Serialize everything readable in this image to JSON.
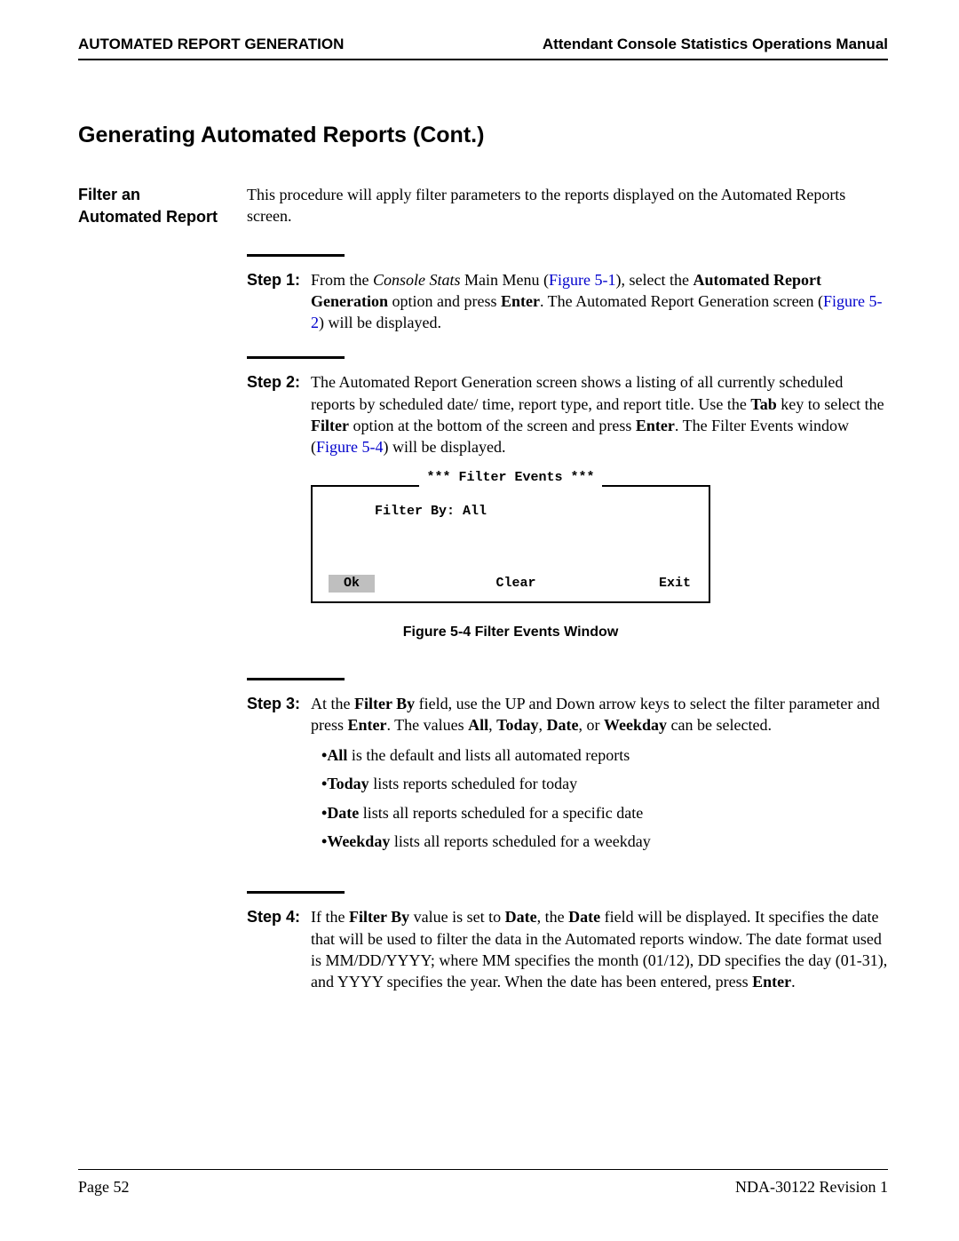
{
  "header": {
    "left": "AUTOMATED REPORT GENERATION",
    "right": "Attendant Console Statistics Operations Manual"
  },
  "section_title": "Generating Automated Reports (Cont.)",
  "left_heading_line1": "Filter an",
  "left_heading_line2": "Automated Report",
  "intro": "This procedure will apply filter parameters to the reports displayed on the Automated Reports screen.",
  "steps": {
    "s1": {
      "label": "Step 1:",
      "pre1": "From the ",
      "italic1": "Console Stats",
      "mid1": " Main Menu (",
      "link1": "Figure 5-1",
      "mid2": "), select the ",
      "bold1": "Automated Report Generation",
      "mid3": " option and press ",
      "bold2": "Enter",
      "mid4": ". The Automated Report Generation screen (",
      "link2": "Figure 5-2",
      "post1": ") will be displayed."
    },
    "s2": {
      "label": "Step 2:",
      "pre1": "The Automated Report Generation screen shows a listing of all currently scheduled reports by scheduled date/ time, report type, and report title. Use the ",
      "bold1": "Tab",
      "mid1": " key to select the ",
      "bold2": "Filter",
      "mid2": " option at the bottom of the screen and press ",
      "bold3": "Enter",
      "mid3": ". The Filter Events window (",
      "link1": "Figure 5-4",
      "post1": ") will be displayed."
    },
    "s3": {
      "label": "Step 3:",
      "pre1": "At the ",
      "bold1": "Filter By",
      "mid1": " field, use the UP and Down arrow keys to select the filter parameter and press ",
      "bold2": "Enter",
      "mid2": ". The values ",
      "bold3": "All",
      "mid3": ", ",
      "bold4": "Today",
      "mid4": ", ",
      "bold5": "Date",
      "mid5": ", or ",
      "bold6": "Weekday",
      "post1": " can be selected.",
      "bullets": {
        "b1_bold": "All",
        "b1_text": " is the default and lists all automated reports",
        "b2_bold": "Today",
        "b2_text": " lists reports scheduled for today",
        "b3_bold": "Date",
        "b3_text": " lists all reports scheduled for a specific date",
        "b4_bold": "Weekday",
        "b4_text": " lists all reports scheduled for a weekday"
      }
    },
    "s4": {
      "label": "Step 4:",
      "pre1": "If the ",
      "bold1": "Filter By",
      "mid1": " value is set to ",
      "bold2": "Date",
      "mid2": ", the ",
      "bold3": "Date",
      "mid3": " field will be displayed. It specifies the date that will be used to filter the data in the Automated reports window. The date format used is MM/DD/YYYY; where MM specifies the month (01/12), DD specifies the day (01-31), and YYYY specifies the year. When the date has been entered, press ",
      "bold4": "Enter",
      "post1": "."
    }
  },
  "figure": {
    "title": "*** Filter Events ***",
    "body": "Filter By: All",
    "btn_ok": "Ok",
    "btn_clear": "Clear",
    "btn_exit": "Exit",
    "caption": "Figure 5-4   Filter Events Window"
  },
  "footer": {
    "left": "Page 52",
    "right": "NDA-30122   Revision 1"
  }
}
